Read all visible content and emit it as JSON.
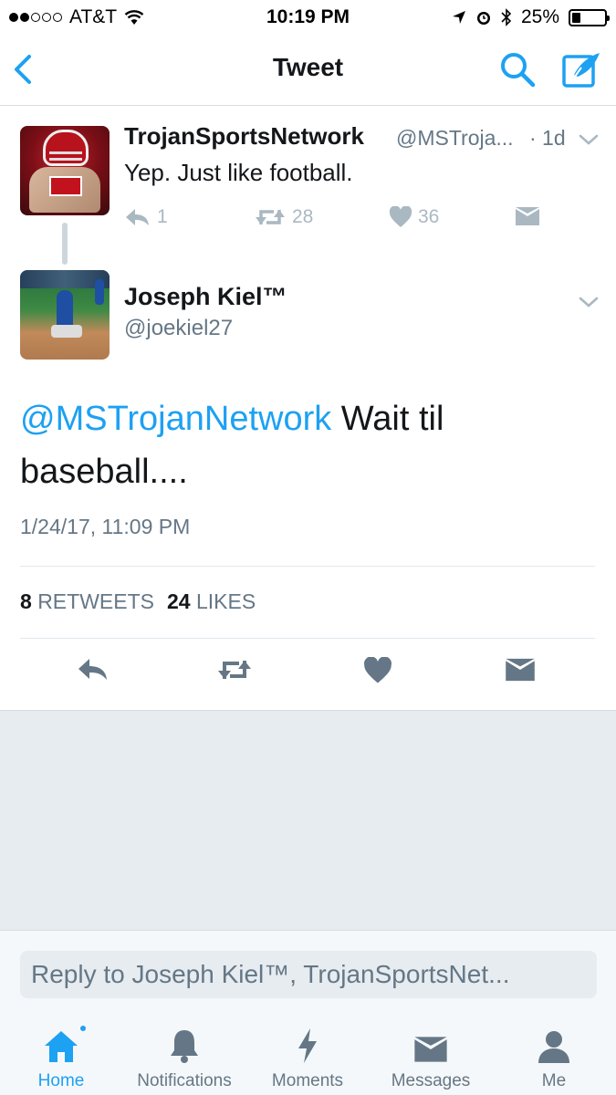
{
  "status": {
    "carrier": "AT&T",
    "time": "10:19 PM",
    "battery": "25%",
    "battery_level": 0.25
  },
  "nav": {
    "title": "Tweet"
  },
  "parent_tweet": {
    "name": "TrojanSportsNetwork",
    "handle": "@MSTroja...",
    "age": "· 1d",
    "text": "Yep. Just like football.",
    "replies": "1",
    "retweets": "28",
    "likes": "36"
  },
  "main_tweet": {
    "name": "Joseph Kiel™",
    "handle": "@joekiel27",
    "mention": "@MSTrojanNetwork",
    "text_rest": " Wait til baseball....",
    "timestamp": "1/24/17, 11:09 PM",
    "retweet_count": "8",
    "retweet_label": "RETWEETS",
    "like_count": "24",
    "like_label": "LIKES"
  },
  "reply": {
    "placeholder": "Reply to Joseph Kiel™, TrojanSportsNet..."
  },
  "tabs": [
    {
      "label": "Home",
      "icon": "home-icon",
      "active": true
    },
    {
      "label": "Notifications",
      "icon": "bell-icon"
    },
    {
      "label": "Moments",
      "icon": "lightning-icon"
    },
    {
      "label": "Messages",
      "icon": "envelope-icon"
    },
    {
      "label": "Me",
      "icon": "person-icon"
    }
  ],
  "colors": {
    "accent": "#1da1f2",
    "text": "#14171a",
    "secondary": "#657786",
    "action_gray": "#aab8c2"
  }
}
